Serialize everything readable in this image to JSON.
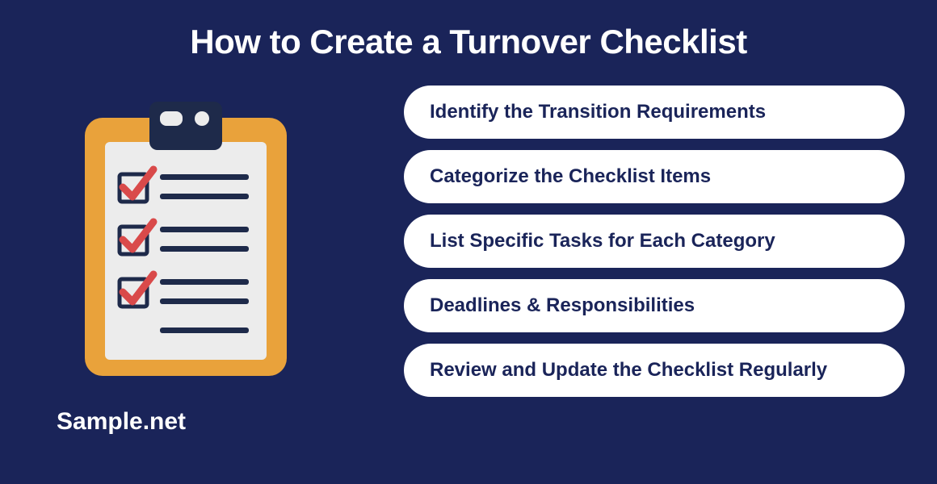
{
  "title": "How to Create a Turnover Checklist",
  "brand": "Sample.net",
  "steps": [
    "Identify the Transition Requirements",
    "Categorize the Checklist Items",
    "List Specific Tasks for Each Category",
    "Deadlines & Responsibilities",
    "Review and Update the Checklist Regularly"
  ]
}
